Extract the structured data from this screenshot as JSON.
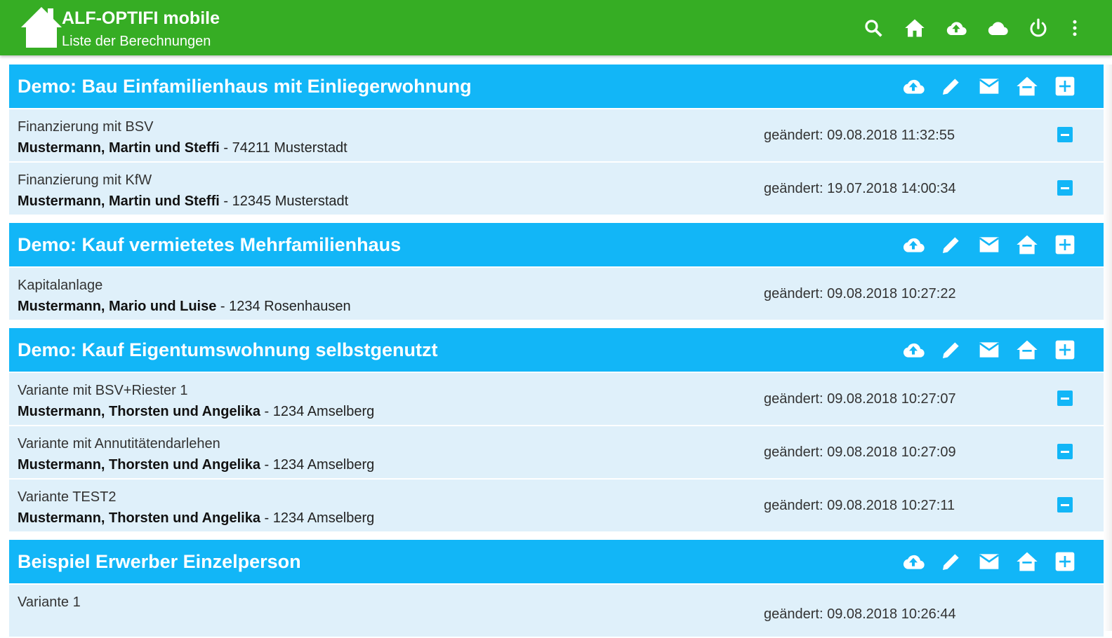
{
  "appbar": {
    "title": "ALF-OPTIFI mobile",
    "subtitle": "Liste der Berechnungen",
    "icons": [
      "home-logo-icon",
      "search-icon",
      "home-icon",
      "cloud-upload-icon",
      "cloud-icon",
      "power-icon",
      "more-vert-icon"
    ],
    "color": "#36ad24"
  },
  "colors": {
    "header_blue": "#12b6f7",
    "row_bg": "#dff0fa"
  },
  "groups": [
    {
      "title": "Demo: Bau Einfamilienhaus mit Einliegerwohnung",
      "actions": [
        "cloud-upload-icon",
        "edit-icon",
        "mail-icon",
        "home-icon",
        "add-box-icon"
      ],
      "items": [
        {
          "name": "Finanzierung mit BSV",
          "person": "Mustermann, Martin und Steffi",
          "location": " - 74211 Musterstadt",
          "date": "geändert: 09.08.2018 11:32:55",
          "removable": true
        },
        {
          "name": "Finanzierung mit KfW",
          "person": "Mustermann, Martin und Steffi",
          "location": " - 12345 Musterstadt",
          "date": "geändert: 19.07.2018 14:00:34",
          "removable": true
        }
      ]
    },
    {
      "title": "Demo: Kauf vermietetes Mehrfamilienhaus",
      "actions": [
        "cloud-upload-icon",
        "edit-icon",
        "mail-icon",
        "home-icon",
        "add-box-icon"
      ],
      "items": [
        {
          "name": "Kapitalanlage",
          "person": "Mustermann, Mario und Luise",
          "location": " - 1234 Rosenhausen",
          "date": "geändert: 09.08.2018 10:27:22",
          "removable": false
        }
      ]
    },
    {
      "title": "Demo: Kauf Eigentumswohnung selbstgenutzt",
      "actions": [
        "cloud-upload-icon",
        "edit-icon",
        "mail-icon",
        "home-icon",
        "add-box-icon"
      ],
      "items": [
        {
          "name": "Variante mit BSV+Riester 1",
          "person": "Mustermann, Thorsten und Angelika",
          "location": " - 1234 Amselberg",
          "date": "geändert: 09.08.2018 10:27:07",
          "removable": true
        },
        {
          "name": "Variante mit Annutitätendarlehen",
          "person": "Mustermann, Thorsten und Angelika",
          "location": " - 1234 Amselberg",
          "date": "geändert: 09.08.2018 10:27:09",
          "removable": true
        },
        {
          "name": "Variante TEST2",
          "person": "Mustermann, Thorsten und Angelika",
          "location": " - 1234 Amselberg",
          "date": "geändert: 09.08.2018 10:27:11",
          "removable": true
        }
      ]
    },
    {
      "title": "Beispiel Erwerber Einzelperson",
      "actions": [
        "cloud-upload-icon",
        "edit-icon",
        "mail-icon",
        "home-icon",
        "add-box-icon"
      ],
      "items": [
        {
          "name": "Variante 1",
          "person": "",
          "location": "",
          "date": "geändert: 09.08.2018 10:26:44",
          "removable": false
        }
      ]
    }
  ]
}
